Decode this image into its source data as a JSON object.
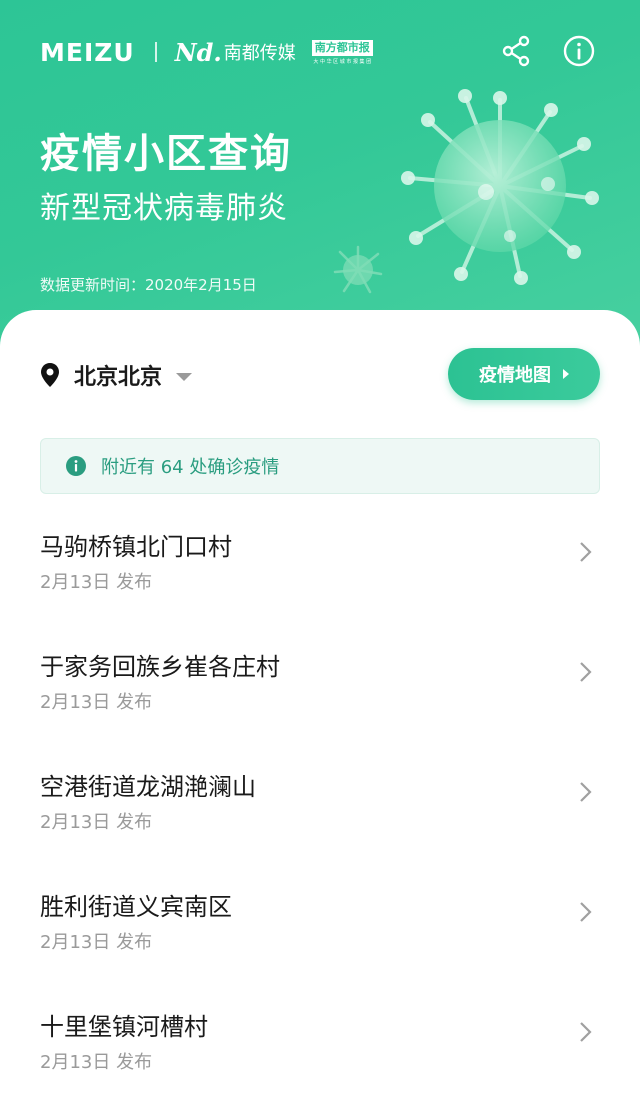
{
  "header": {
    "brand_meizu": "MEIZU",
    "brand_nd": "Nd.",
    "brand_media": "南都传媒",
    "brand_paper_title": "南方都市报",
    "brand_paper_sub": "大 中 华 区 城 市 报 集 团",
    "title": "疫情小区查询",
    "subtitle": "新型冠状病毒肺炎",
    "update_time": "数据更新时间：2020年2月15日",
    "icons": [
      "share-icon",
      "info-icon"
    ]
  },
  "location": {
    "city": "北京北京",
    "icon": "location-pin-icon"
  },
  "map_button": {
    "label": "疫情地图"
  },
  "notice": {
    "text": "附近有 64 处确诊疫情",
    "icon": "info-circle-icon"
  },
  "list": {
    "items": [
      {
        "name": "马驹桥镇北门口村",
        "date": "2月13日 发布"
      },
      {
        "name": "于家务回族乡崔各庄村",
        "date": "2月13日 发布"
      },
      {
        "name": "空港街道龙湖滟澜山",
        "date": "2月13日 发布"
      },
      {
        "name": "胜利街道义宾南区",
        "date": "2月13日 发布"
      },
      {
        "name": "十里堡镇河槽村",
        "date": "2月13日 发布"
      }
    ]
  },
  "colors": {
    "accent": "#2dc596",
    "notice_bg": "#eef8f5",
    "notice_text": "#2a9d80",
    "secondary_text": "#9a9a9a"
  }
}
